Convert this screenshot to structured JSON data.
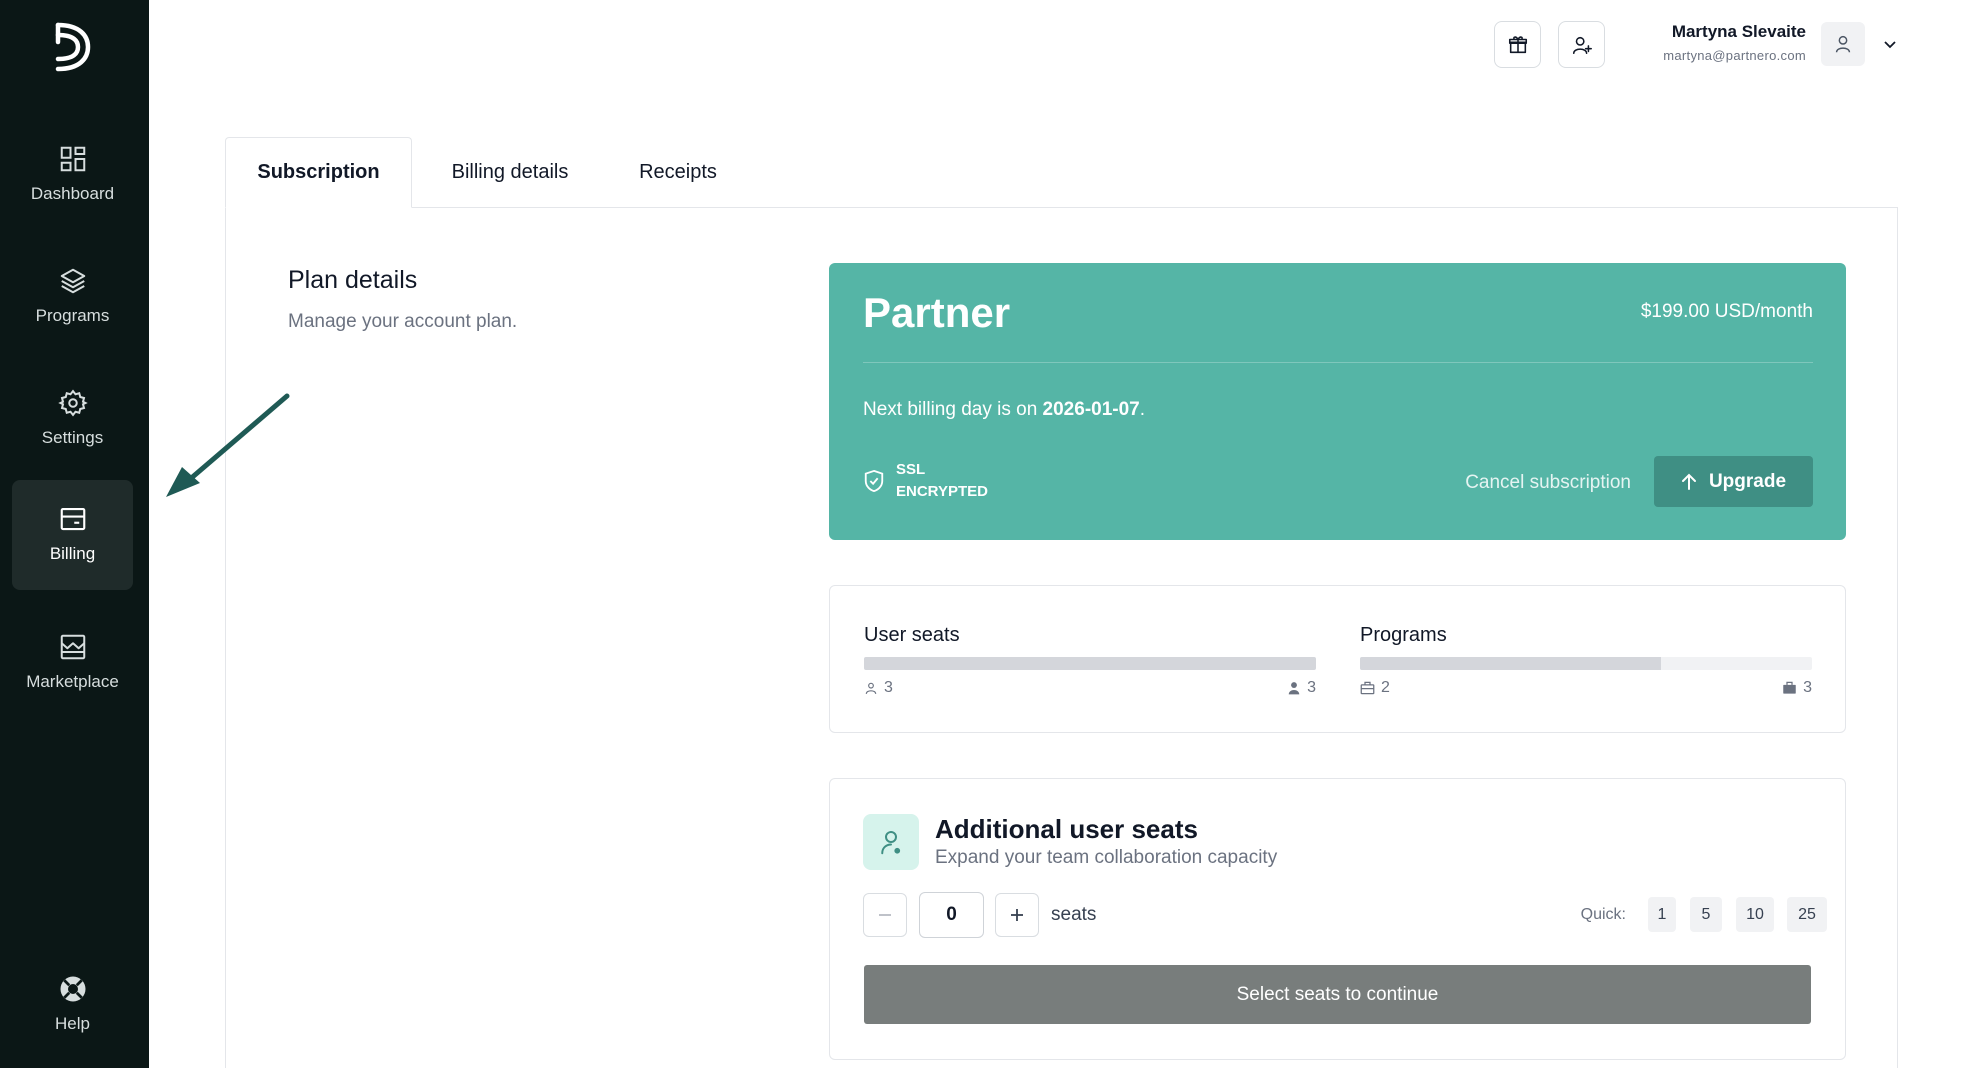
{
  "sidebar": {
    "items": [
      {
        "label": "Dashboard",
        "icon": "dashboard-icon"
      },
      {
        "label": "Programs",
        "icon": "layers-icon"
      },
      {
        "label": "Settings",
        "icon": "gear-icon"
      },
      {
        "label": "Billing",
        "icon": "credit-card-icon",
        "active": true
      },
      {
        "label": "Marketplace",
        "icon": "store-icon"
      }
    ],
    "help": {
      "label": "Help",
      "icon": "lifebuoy-icon"
    }
  },
  "header": {
    "user_name": "Martyna Slevaite",
    "user_email": "martyna@partnero.com"
  },
  "tabs": [
    {
      "label": "Subscription",
      "active": true
    },
    {
      "label": "Billing details"
    },
    {
      "label": "Receipts"
    }
  ],
  "plan": {
    "title": "Plan details",
    "subtitle": "Manage your account plan."
  },
  "partner_card": {
    "name": "Partner",
    "price": "$199.00 USD/month",
    "billing_prefix": "Next billing day is on ",
    "billing_date": "2026-01-07",
    "billing_suffix": ".",
    "ssl_line1": "SSL",
    "ssl_line2": "ENCRYPTED",
    "cancel_label": "Cancel subscription",
    "upgrade_label": "Upgrade",
    "color": "#55b5a6"
  },
  "usage": {
    "user_seats": {
      "title": "User seats",
      "used": "3",
      "limit": "3",
      "fill": 1.0
    },
    "programs": {
      "title": "Programs",
      "used": "2",
      "limit": "3",
      "fill": 0.6667
    }
  },
  "additional_seats": {
    "title": "Additional user seats",
    "subtitle": "Expand your team collaboration capacity",
    "value": "0",
    "unit": "seats",
    "quick_label": "Quick:",
    "quick_options": [
      "1",
      "5",
      "10",
      "25"
    ],
    "continue_label": "Select seats to continue"
  }
}
